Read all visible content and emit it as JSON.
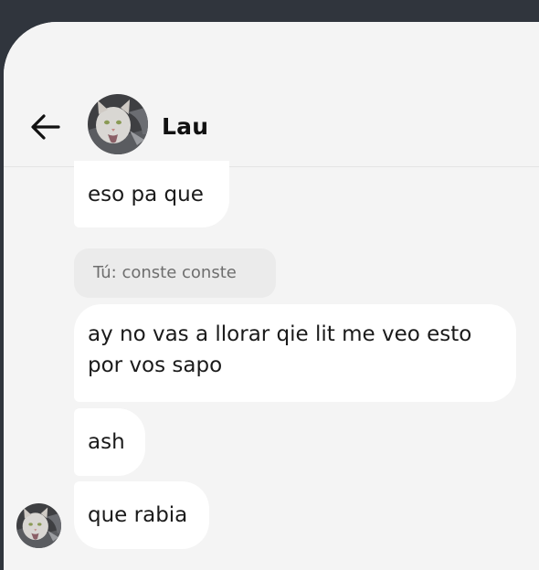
{
  "header": {
    "back_icon": "arrow-left-icon",
    "contact_name": "Lau"
  },
  "messages": [
    {
      "text": "eso pa que"
    },
    {
      "reply_context": "Tú: conste conste"
    },
    {
      "line1": "ay no vas a llorar qie lit me veo esto",
      "line2": "por vos sapo"
    },
    {
      "text": "ash"
    },
    {
      "text": "que rabia"
    }
  ]
}
